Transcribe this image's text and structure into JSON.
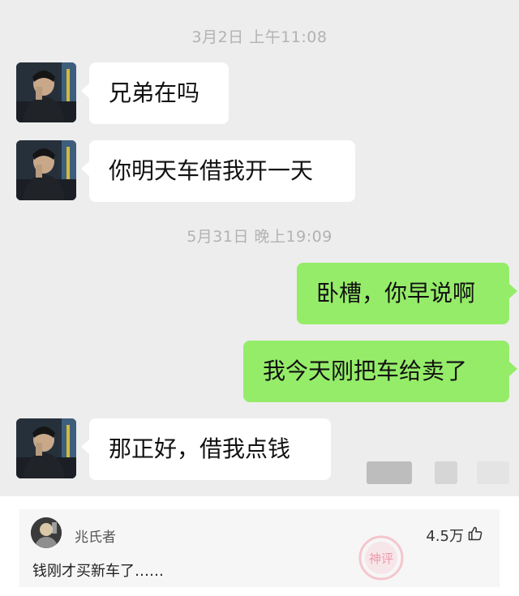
{
  "chat": {
    "timestamp_1": "3月2日 上午11:08",
    "timestamp_2": "5月31日 晚上19:09",
    "messages": [
      {
        "side": "in",
        "text": "兄弟在吗"
      },
      {
        "side": "in",
        "text": "你明天车借我开一天"
      },
      {
        "side": "out",
        "text": "卧槽，你早说啊"
      },
      {
        "side": "out",
        "text": "我今天刚把车给卖了"
      },
      {
        "side": "in",
        "text": "那正好，借我点钱"
      }
    ]
  },
  "comment": {
    "username": "兆氏者",
    "likes": "4.5万",
    "text": "钱刚才买新车了……",
    "like_icon": "thumbs-up-icon",
    "watermark_text": "神评"
  },
  "colors": {
    "chat_background": "#ededed",
    "incoming_bubble": "#ffffff",
    "outgoing_bubble": "#95ec69",
    "comment_background": "#f6f6f6"
  }
}
